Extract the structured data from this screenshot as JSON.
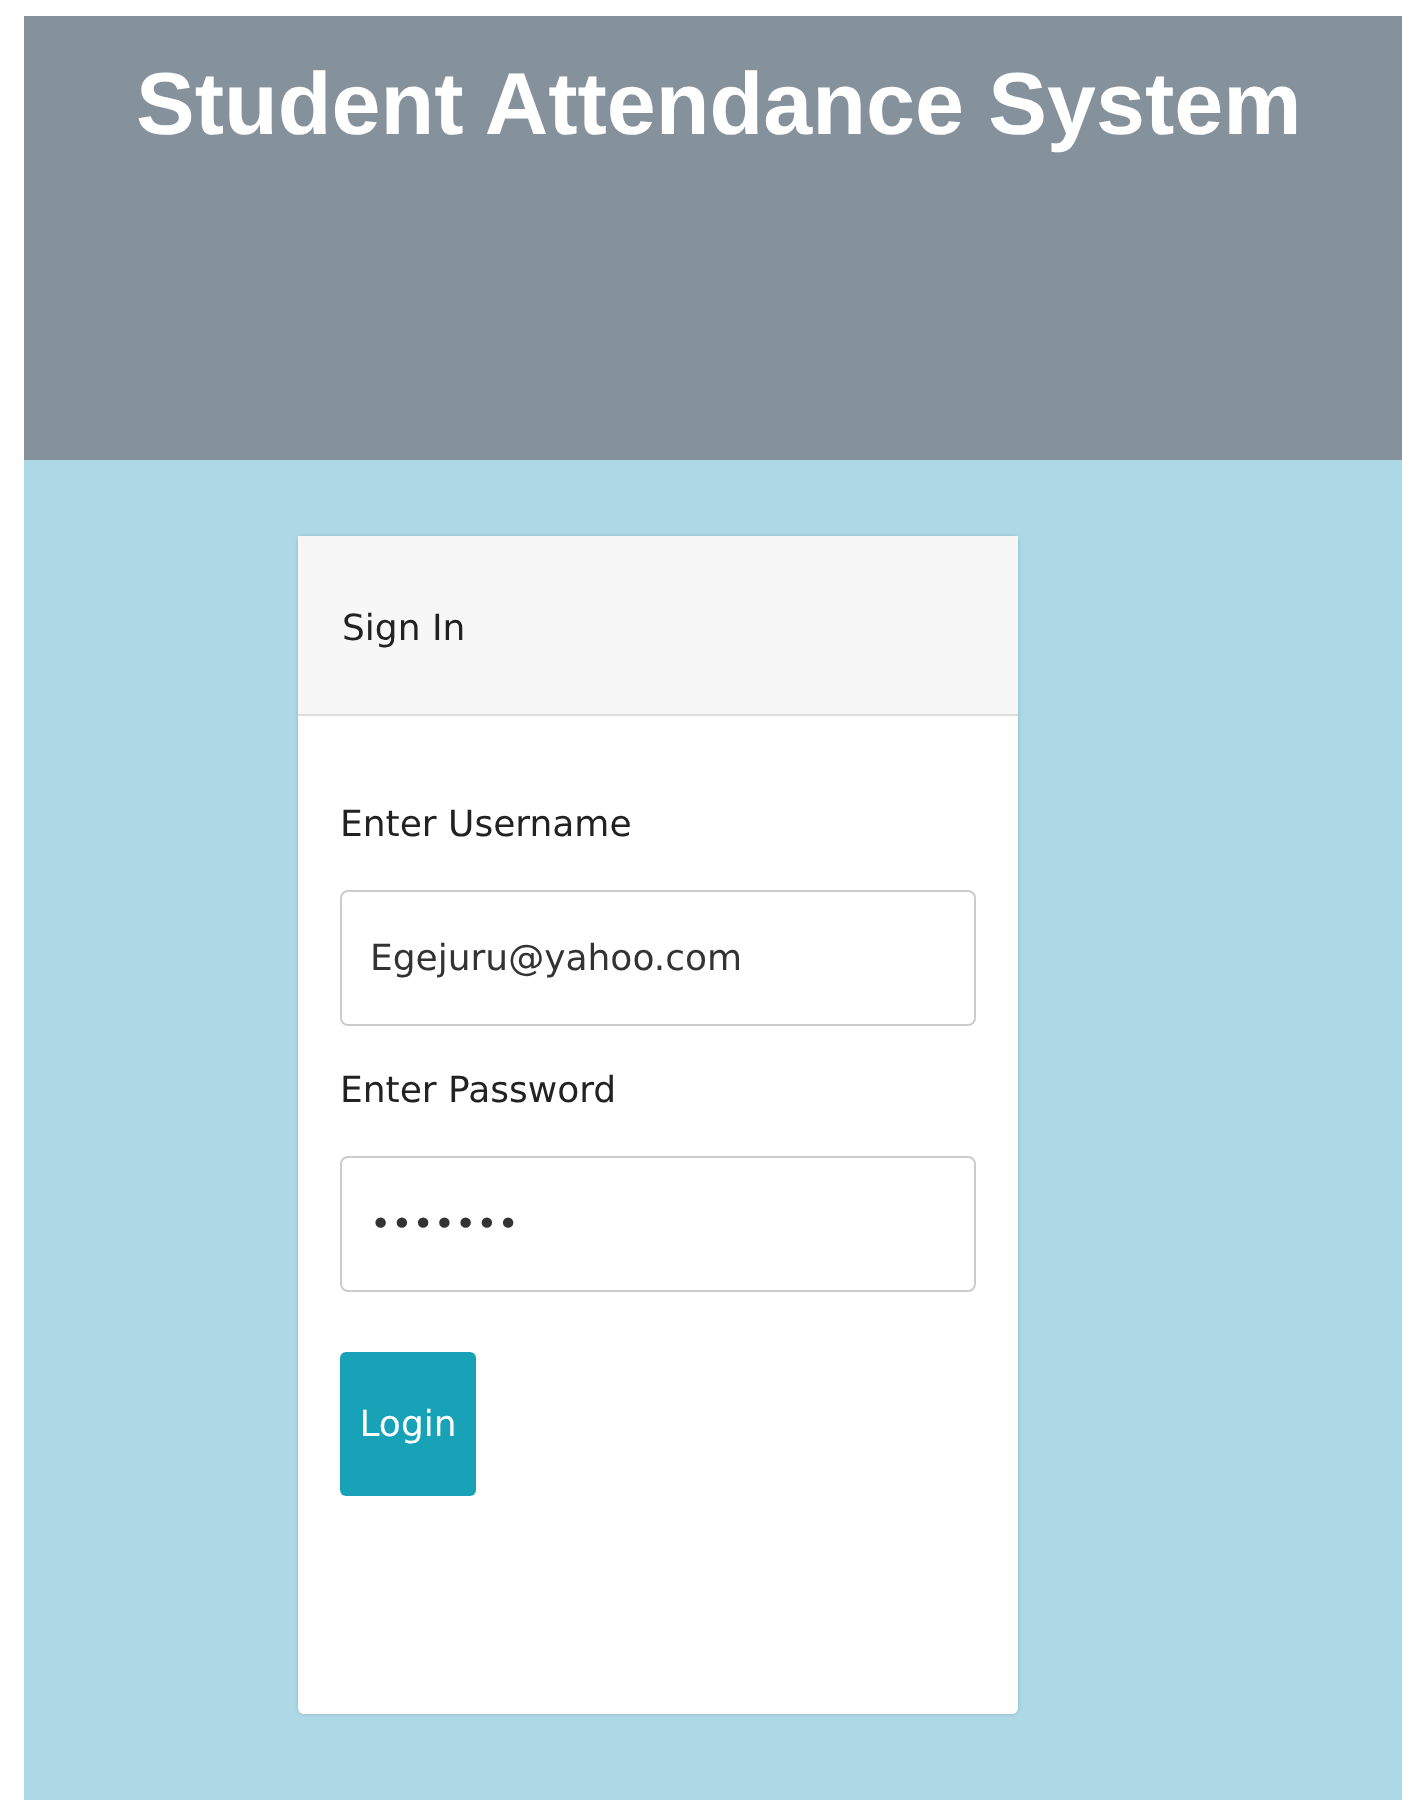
{
  "header": {
    "title": "Student Attendance System"
  },
  "card": {
    "title": "Sign In",
    "fields": [
      {
        "label": "Enter Username",
        "value": "Egejuru@yahoo.com"
      },
      {
        "label": "Enter Password",
        "value": "•••••••"
      }
    ],
    "button": "Login"
  }
}
